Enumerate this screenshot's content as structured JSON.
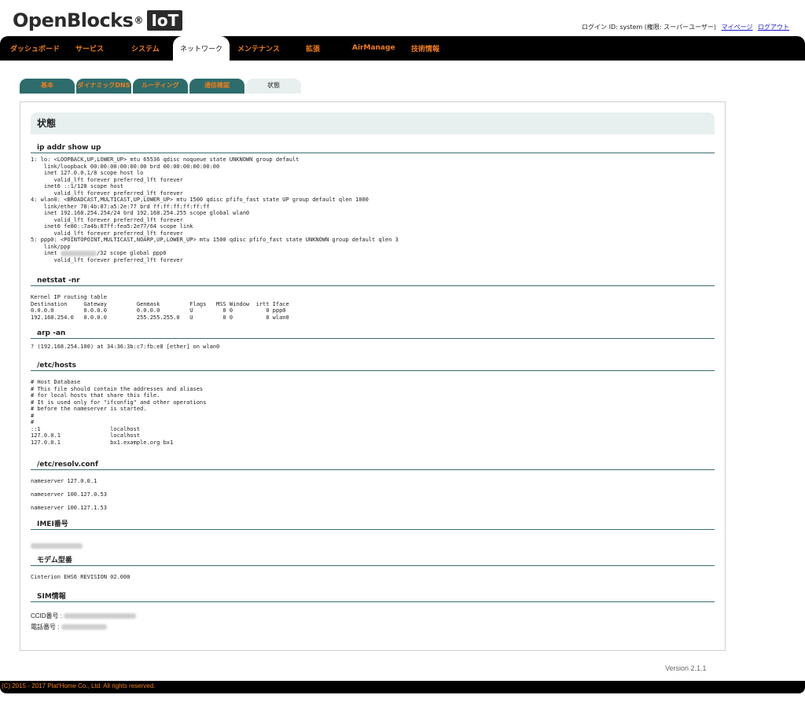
{
  "brand": {
    "name": "OpenBlocks",
    "reg": "®",
    "badge": "IoT"
  },
  "user_bar": {
    "login_info": "ログイン ID: system (権限: スーパーユーザー)",
    "mypage_link": "マイページ",
    "logout_link": "ログアウト"
  },
  "main_nav": {
    "dashboard": "ダッシュボード",
    "services": "サービス",
    "system": "システム",
    "network": "ネットワーク",
    "maintenance": "メンテナンス",
    "extension": "拡張",
    "airmanage": "AirManage",
    "techinfo": "技術情報"
  },
  "sub_tabs": {
    "basic": "基本",
    "ddns": "ダイナミックDNS",
    "routing": "ルーティング",
    "comm_check": "通信確認",
    "status": "状態"
  },
  "panel": {
    "title": "状態",
    "ip_addr": {
      "heading": "ip addr show up",
      "lines_a": "1: lo: <LOOPBACK,UP,LOWER_UP> mtu 65536 qdisc noqueue state UNKNOWN group default\n    link/loopback 00:00:00:00:00:00 brd 00:00:00:00:00:00\n    inet 127.0.0.1/8 scope host lo\n       valid_lft forever preferred_lft forever\n    inet6 ::1/128 scope host\n       valid_lft forever preferred_lft forever\n4: wlan0: <BROADCAST,MULTICAST,UP,LOWER_UP> mtu 1500 qdisc pfifo_fast state UP group default qlen 1000\n    link/ether 78:4b:87:a5:2e:77 brd ff:ff:ff:ff:ff:ff\n    inet 192.168.254.254/24 brd 192.168.254.255 scope global wlan0\n       valid_lft forever preferred_lft forever\n    inet6 fe80::7a4b:87ff:fea5:2e77/64 scope link\n       valid_lft forever preferred_lft forever\n5: ppp0: <POINTOPOINT,MULTICAST,NOARP,UP,LOWER_UP> mtu 1500 qdisc pfifo_fast state UNKNOWN group default qlen 3\n    link/ppp",
      "inet_prefix": "    inet ",
      "inet_suffix": "/32 scope global ppp0",
      "lines_b": "       valid_lft forever preferred_lft forever"
    },
    "netstat": {
      "heading": "netstat -nr",
      "text": "Kernel IP routing table\nDestination     Gateway         Genmask         Flags   MSS Window  irtt Iface\n0.0.0.0         0.0.0.0         0.0.0.0         U         0 0          0 ppp0\n192.168.254.0   0.0.0.0         255.255.255.0   U         0 0          0 wlan0"
    },
    "arp": {
      "heading": "arp -an",
      "text": "? (192.168.254.100) at 34:36:3b:c7:fb:e8 [ether] on wlan0"
    },
    "hosts": {
      "heading": "/etc/hosts",
      "text": "# Host Database\n# This file should contain the addresses and aliases\n# for local hosts that share this file.\n# It is used only for \"ifconfig\" and other operations\n# before the nameserver is started.\n#\n#\n::1                     localhost\n127.0.0.1               localhost\n127.0.0.1               bx1.example.org bx1"
    },
    "resolv": {
      "heading": "/etc/resolv.conf",
      "ns1": "nameserver 127.0.0.1",
      "ns2": "nameserver 100.127.0.53",
      "ns3": "nameserver 100.127.1.53"
    },
    "imei": {
      "heading": "IMEI番号"
    },
    "modem": {
      "heading": "モデム型番",
      "value": "Cinterion EHS6 REVISION 02.000"
    },
    "sim": {
      "heading": "SIM情報",
      "ccid_label": "CCID番号 : ",
      "phone_label": "電話番号 : "
    }
  },
  "version": "Version 2.1.1",
  "footer": "(C) 2015 - 2017 Plat'Home Co., Ltd. All rights reserved."
}
